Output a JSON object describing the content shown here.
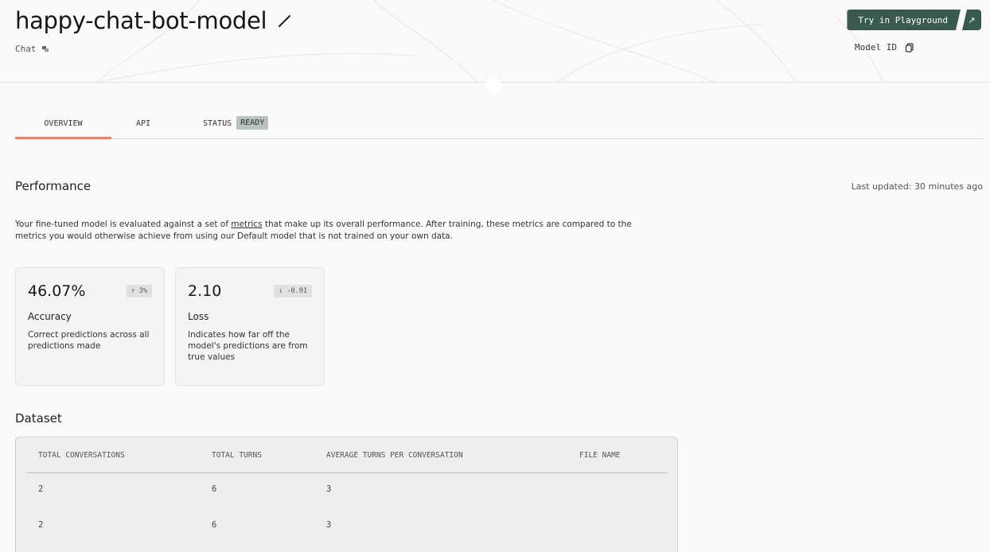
{
  "header": {
    "title": "happy-chat-bot-model",
    "subtitle": "Chat",
    "try_playground_label": "Try in Playground",
    "external_arrow": "↗",
    "model_id_label": "Model ID"
  },
  "tabs": [
    {
      "label": "OVERVIEW",
      "active": true
    },
    {
      "label": "API",
      "active": false
    },
    {
      "label": "STATUS",
      "active": false,
      "badge": "READY"
    }
  ],
  "performance": {
    "title": "Performance",
    "last_updated": "Last updated: 30 minutes ago",
    "description_before": "Your fine-tuned model is evaluated against a set of ",
    "description_link": "metrics",
    "description_after": " that make up its overall performance. After training, these metrics are compared to the metrics you would otherwise achieve from using our Default model that is not trained on your own data.",
    "metrics": [
      {
        "value": "46.07%",
        "delta": "↑ 3%",
        "name": "Accuracy",
        "description": "Correct predictions across all predictions made"
      },
      {
        "value": "2.10",
        "delta": "↓ -0.91",
        "name": "Loss",
        "description": "Indicates how far off the model's predictions are from true values"
      }
    ]
  },
  "dataset": {
    "title": "Dataset",
    "columns": [
      "TOTAL CONVERSATIONS",
      "TOTAL TURNS",
      "AVERAGE TURNS PER CONVERSATION",
      "FILE NAME"
    ],
    "rows": [
      [
        "2",
        "6",
        "3",
        ""
      ],
      [
        "2",
        "6",
        "3",
        ""
      ]
    ]
  },
  "colors": {
    "accent_tab": "#e8836b",
    "button_bg": "#3a5a4d",
    "status_badge_bg": "#b9c3bd"
  }
}
